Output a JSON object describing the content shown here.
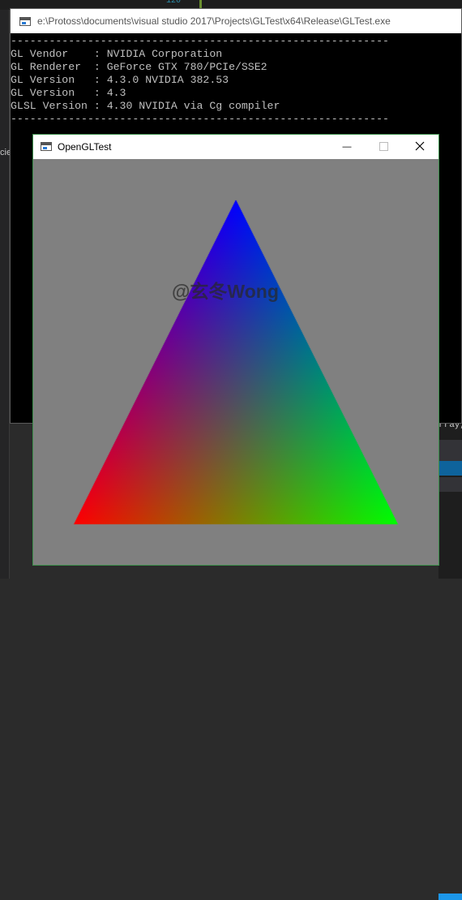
{
  "console": {
    "title": "e:\\Protoss\\documents\\visual studio 2017\\Projects\\GLTest\\x64\\Release\\GLTest.exe",
    "lines": [
      "-----------------------------------------------------------",
      "GL Vendor    : NVIDIA Corporation",
      "GL Renderer  : GeForce GTX 780/PCIe/SSE2",
      "GL Version   : 4.3.0 NVIDIA 382.53",
      "GL Version   : 4.3",
      "GLSL Version : 4.30 NVIDIA via Cg compiler",
      "-----------------------------------------------------------"
    ]
  },
  "gl_window": {
    "title": "OpenGLTest",
    "minimize_glyph": "—",
    "maximize_glyph": "☐",
    "close_glyph": "✕",
    "background_color": "#808080",
    "triangle_vertex_colors": {
      "top": "#0000ff",
      "bottom_left": "#ff0000",
      "bottom_right": "#00ff00"
    }
  },
  "ide": {
    "line_number": "120",
    "left_fragment": "cie",
    "right_fragment": "rray,"
  },
  "watermark": "@玄冬Wong"
}
